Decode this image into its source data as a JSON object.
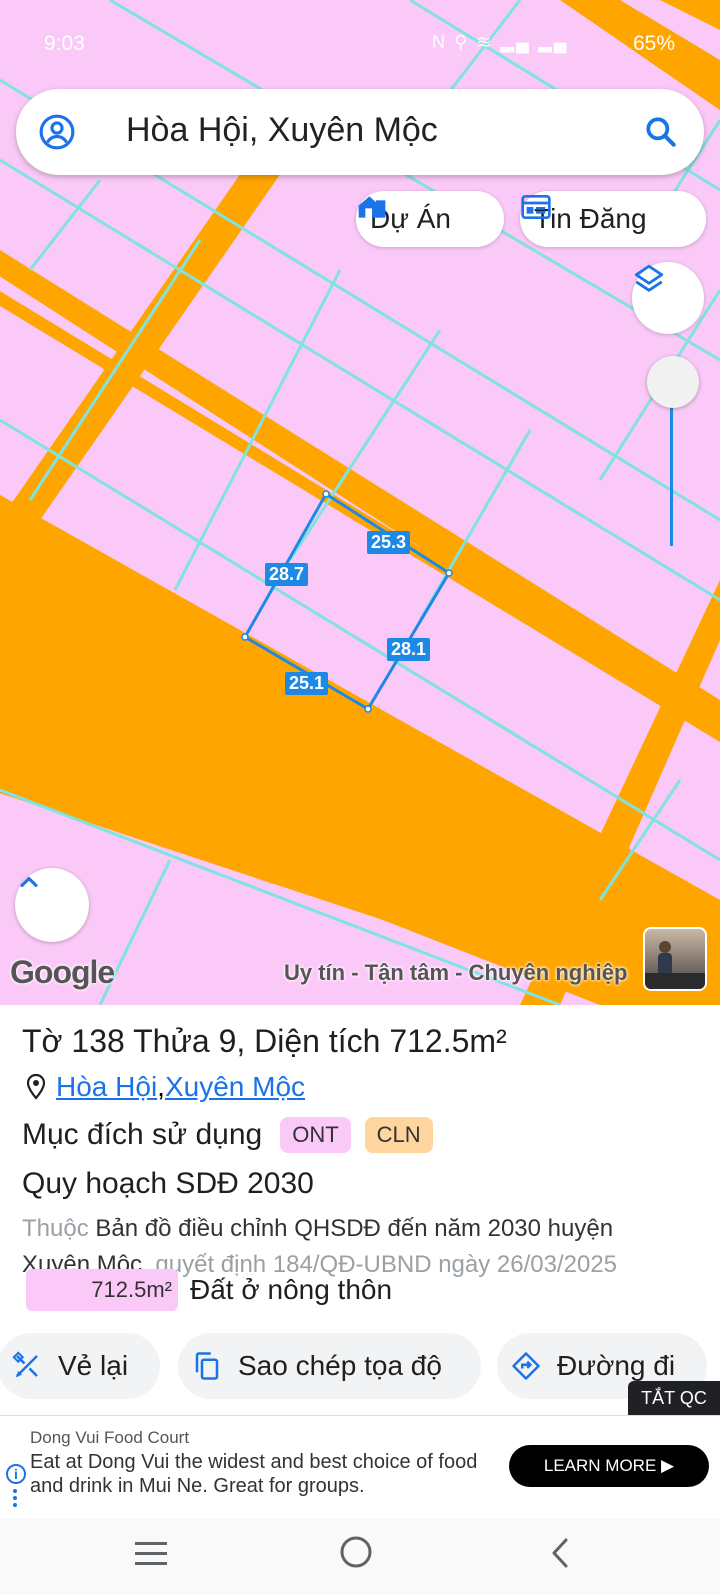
{
  "status_bar": {
    "time": "9:03",
    "icons": "N ⚲ ≋ ▂▄ ▂▄",
    "battery": "65%"
  },
  "search": {
    "text": "Hòa Hội, Xuyên Mộc"
  },
  "chips": {
    "du_an": "Dự Án",
    "tin_dang": "Tin Đăng"
  },
  "map": {
    "logo": "Google",
    "tagline": "Uy tín - Tận tâm - Chuyên nghiệp",
    "dimensions": {
      "top": "25.3",
      "left": "28.7",
      "right": "28.1",
      "bottom": "25.1"
    },
    "colors": {
      "residential_land": "#fbc9f7",
      "road": "#ffa500",
      "parcel_outline": "#1e88e5"
    }
  },
  "parcel": {
    "title": "Tờ 138 Thửa 9, Diện tích 712.5m²",
    "commune": "Hòa Hội",
    "separator": ", ",
    "district": "Xuyên Mộc",
    "usage_label": "Mục đích sử dụng",
    "usage_codes": [
      "ONT",
      "CLN"
    ],
    "plan_title": "Quy hoạch SDĐ 2030",
    "plan_prefix": "Thuộc",
    "plan_map": "Bản đồ điều chỉnh QHSDĐ đến năm 2030 huyện Xuyên Mộc",
    "plan_decision": ", quyết định 184/QĐ-UBND ngày 26/03/2025",
    "area_value": "712.5m²",
    "area_type": "Đất ở nông thôn"
  },
  "actions": {
    "redraw": "Vẻ lại",
    "copy_coords": "Sao chép tọa độ",
    "directions": "Đường đi"
  },
  "ad": {
    "hide_label": "TẮT QC",
    "advertiser": "Dong Vui Food Court",
    "body": "Eat at Dong Vui the widest and best choice of food and drink in Mui Ne. Great for groups.",
    "cta": "LEARN MORE ▶"
  }
}
